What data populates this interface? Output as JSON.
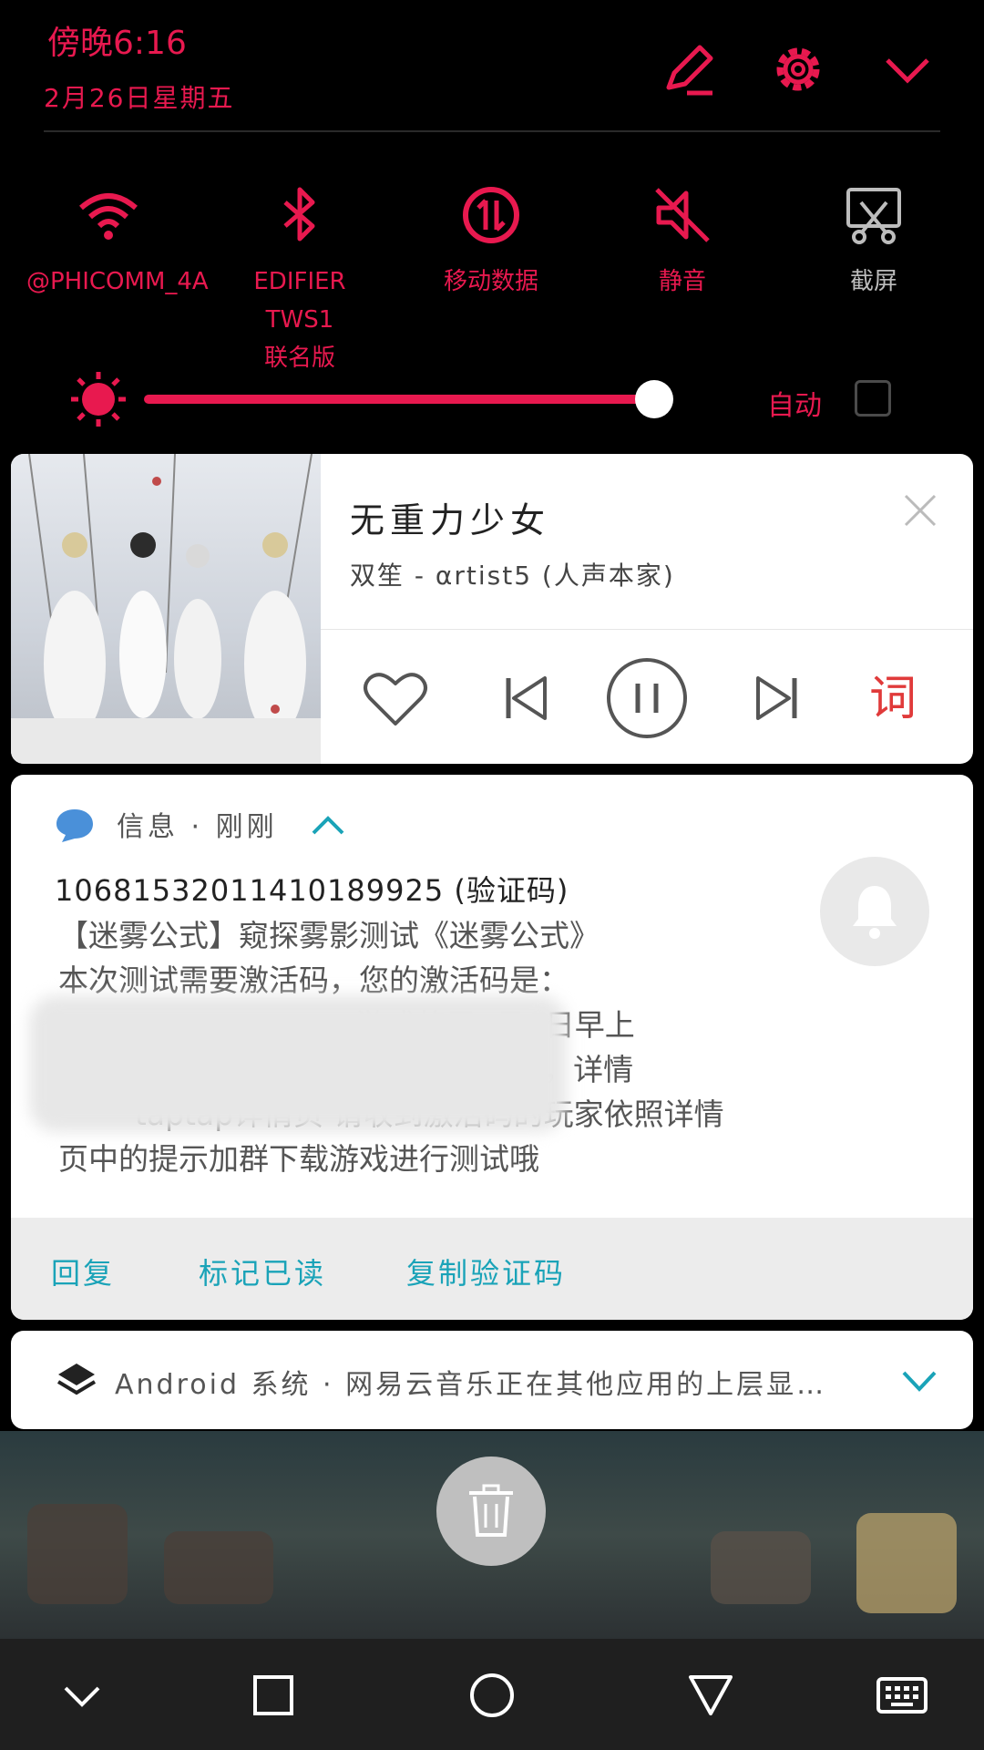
{
  "header": {
    "time": "傍晚6:16",
    "date": "2月26日星期五",
    "icons": [
      "edit-icon",
      "settings-gear-icon",
      "collapse-chevron-icon"
    ]
  },
  "quick_settings": [
    {
      "label": "@PHICOMM_4A",
      "icon": "wifi-icon",
      "active": true
    },
    {
      "label": "EDIFIER TWS1\n联名版",
      "icon": "bluetooth-icon",
      "active": true
    },
    {
      "label": "移动数据",
      "icon": "mobile-data-icon",
      "active": true
    },
    {
      "label": "静音",
      "icon": "mute-icon",
      "active": true
    },
    {
      "label": "截屏",
      "icon": "screenshot-icon",
      "active": false
    }
  ],
  "brightness": {
    "level": 0.88,
    "auto_label": "自动",
    "auto_checked": false
  },
  "music": {
    "title": "无重力少女",
    "artist": "双笙 - αrtist5 (人声本家)",
    "controls": [
      "like-heart-icon",
      "previous-track-icon",
      "pause-icon",
      "next-track-icon",
      "lyrics-icon"
    ]
  },
  "notification": {
    "app": "信息",
    "time": "刚刚",
    "meta": "信息 · 刚刚",
    "sender": "10681532011410189925 (验证码)",
    "body": "【迷雾公式】窥探雾影测试《迷雾公式》\n本次测试需要激活码，您的激活码是：\n                          5，游戏将于3月3日早上\n                                   上传安装包，详情\n        taptap详情页 请收到激活码的玩家依照详情\n页中的提示加群下载游戏进行测试哦",
    "actions": {
      "reply": "回复",
      "mark_read": "标记已读",
      "copy_code": "复制验证码"
    }
  },
  "system_notification": {
    "text": "Android 系统 · 网易云音乐正在其他应用的上层显…"
  },
  "colors": {
    "accent": "#e8194f",
    "action": "#1aa3b8",
    "background": "#000000"
  }
}
